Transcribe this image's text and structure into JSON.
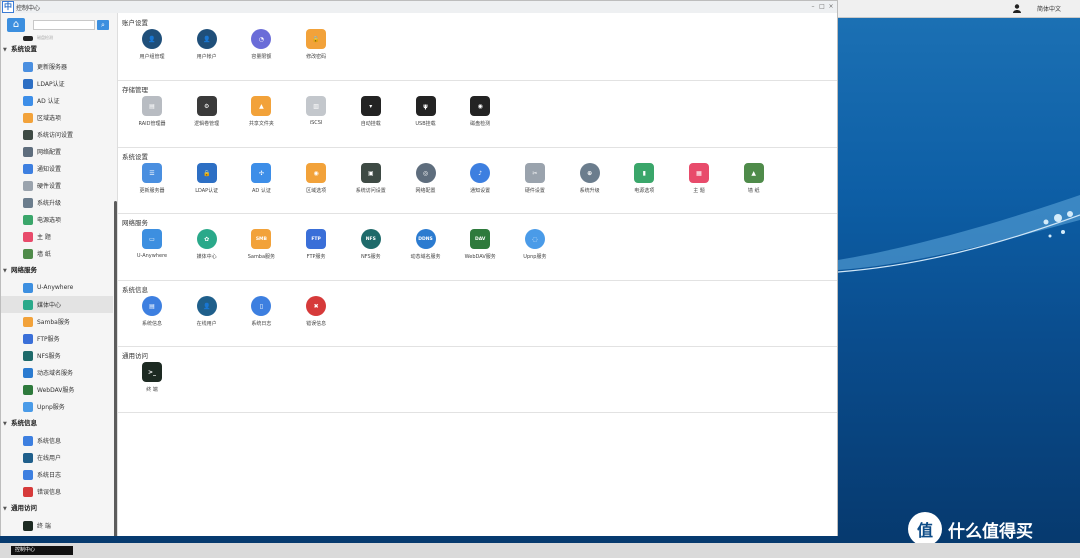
{
  "window": {
    "title": "控制中心",
    "app_icon": "中"
  },
  "desktop": {
    "language": "简体中文",
    "brand_badge": "值",
    "brand_text": "什么值得买",
    "taskbar_item": "控制中心"
  },
  "sidebar": {
    "search_placeholder": "",
    "partial_item": "磁盘检测",
    "categories": [
      {
        "label": "系统设置",
        "items": [
          {
            "label": "更新服务器",
            "icon": "server-icon",
            "color": "#4a8fe0"
          },
          {
            "label": "LDAP认证",
            "icon": "ldap-icon",
            "color": "#2d6fc4"
          },
          {
            "label": "AD 认证",
            "icon": "ad-icon",
            "color": "#3d8ee8"
          },
          {
            "label": "区域选项",
            "icon": "region-icon",
            "color": "#f2a23a"
          },
          {
            "label": "系统访问设置",
            "icon": "access-icon",
            "color": "#3e4a44"
          },
          {
            "label": "网络配置",
            "icon": "network-icon",
            "color": "#5e6d7d"
          },
          {
            "label": "通知设置",
            "icon": "bell-icon",
            "color": "#3d7fe0"
          },
          {
            "label": "硬件设置",
            "icon": "hardware-icon",
            "color": "#9aa3ad"
          },
          {
            "label": "系统升级",
            "icon": "upgrade-icon",
            "color": "#6b7d8d"
          },
          {
            "label": "电源选项",
            "icon": "power-icon",
            "color": "#3aa66a"
          },
          {
            "label": "主 题",
            "icon": "theme-icon",
            "color": "#e84b6b"
          },
          {
            "label": "墙 纸",
            "icon": "wallpaper-icon",
            "color": "#4f8b4a"
          }
        ]
      },
      {
        "label": "网络服务",
        "items": [
          {
            "label": "U-Anywhere",
            "icon": "u-anywhere-icon",
            "color": "#3d8fe0"
          },
          {
            "label": "媒体中心",
            "icon": "media-icon",
            "color": "#2aa98a",
            "active": true
          },
          {
            "label": "Samba服务",
            "icon": "samba-icon",
            "color": "#f2a23a"
          },
          {
            "label": "FTP服务",
            "icon": "ftp-icon",
            "color": "#3a6fd8"
          },
          {
            "label": "NFS服务",
            "icon": "nfs-icon",
            "color": "#1e6a6a"
          },
          {
            "label": "动态域名服务",
            "icon": "ddns-icon",
            "color": "#2b7bd0"
          },
          {
            "label": "WebDAV服务",
            "icon": "webdav-icon",
            "color": "#2e7a3c"
          },
          {
            "label": "Upnp服务",
            "icon": "upnp-icon",
            "color": "#4a9be8"
          }
        ]
      },
      {
        "label": "系统信息",
        "items": [
          {
            "label": "系统信息",
            "icon": "info-icon",
            "color": "#3d7fe0"
          },
          {
            "label": "在线用户",
            "icon": "online-user-icon",
            "color": "#1f5f8b"
          },
          {
            "label": "系统日志",
            "icon": "log-icon",
            "color": "#3d7fe0"
          },
          {
            "label": "错误信息",
            "icon": "error-icon",
            "color": "#d63a3a"
          }
        ]
      },
      {
        "label": "通用访问",
        "items": [
          {
            "label": "终 端",
            "icon": "terminal-icon",
            "color": "#1d2a22"
          }
        ]
      }
    ]
  },
  "sections": [
    {
      "title": "账户设置",
      "tiles": [
        {
          "label": "用户组管理",
          "icon": "user-group-icon",
          "color": "#1f4f7a",
          "glyph": "👤",
          "round": true
        },
        {
          "label": "用户帐户",
          "icon": "user-account-icon",
          "color": "#1f4f7a",
          "glyph": "👤",
          "round": true
        },
        {
          "label": "容量限额",
          "icon": "quota-icon",
          "color": "#6a6cd8",
          "glyph": "◔",
          "round": true
        },
        {
          "label": "修改密码",
          "icon": "lock-icon",
          "color": "#f2a23a",
          "glyph": "🔒"
        }
      ]
    },
    {
      "title": "存储管理",
      "tiles": [
        {
          "label": "RAID管理器",
          "icon": "raid-icon",
          "color": "#b8bcc2",
          "glyph": "▤"
        },
        {
          "label": "逻辑卷管理",
          "icon": "lvm-icon",
          "color": "#3a3a3a",
          "glyph": "⚙"
        },
        {
          "label": "共享文件夹",
          "icon": "share-folder-icon",
          "color": "#f2a23a",
          "glyph": "▲"
        },
        {
          "label": "iSCSI",
          "icon": "iscsi-icon",
          "color": "#c3c7cc",
          "glyph": "▥"
        },
        {
          "label": "自动挂载",
          "icon": "automount-icon",
          "color": "#232323",
          "glyph": "▾"
        },
        {
          "label": "USB挂载",
          "icon": "usb-icon",
          "color": "#232323",
          "glyph": "ψ"
        },
        {
          "label": "磁盘检测",
          "icon": "disk-check-icon",
          "color": "#232323",
          "glyph": "◉"
        }
      ]
    },
    {
      "title": "系统设置",
      "tiles": [
        {
          "label": "更新服务器",
          "icon": "server-icon",
          "color": "#4a8fe0",
          "glyph": "☰"
        },
        {
          "label": "LDAP认证",
          "icon": "ldap-icon",
          "color": "#2d6fc4",
          "glyph": "🔒"
        },
        {
          "label": "AD 认证",
          "icon": "ad-icon",
          "color": "#3d8ee8",
          "glyph": "✣"
        },
        {
          "label": "区域选项",
          "icon": "region-icon",
          "color": "#f2a23a",
          "glyph": "◉"
        },
        {
          "label": "系统访问设置",
          "icon": "access-icon",
          "color": "#3e4a44",
          "glyph": "▣"
        },
        {
          "label": "网络配置",
          "icon": "network-icon",
          "color": "#5e6d7d",
          "glyph": "◎",
          "round": true
        },
        {
          "label": "通知设置",
          "icon": "bell-icon",
          "color": "#3d7fe0",
          "glyph": "♪",
          "round": true
        },
        {
          "label": "硬件设置",
          "icon": "hardware-icon",
          "color": "#9aa3ad",
          "glyph": "✂"
        },
        {
          "label": "系统升级",
          "icon": "upgrade-icon",
          "color": "#6b7d8d",
          "glyph": "⊕",
          "round": true
        },
        {
          "label": "电源选项",
          "icon": "power-icon",
          "color": "#3aa66a",
          "glyph": "▮"
        },
        {
          "label": "主 题",
          "icon": "theme-icon",
          "color": "#e84b6b",
          "glyph": "▦"
        },
        {
          "label": "墙 纸",
          "icon": "wallpaper-icon",
          "color": "#4f8b4a",
          "glyph": "▲"
        }
      ]
    },
    {
      "title": "网络服务",
      "tiles": [
        {
          "label": "U-Anywhere",
          "icon": "u-anywhere-icon",
          "color": "#3d8fe0",
          "glyph": "▭"
        },
        {
          "label": "媒体中心",
          "icon": "media-icon",
          "color": "#2aa98a",
          "glyph": "✿",
          "round": true
        },
        {
          "label": "Samba服务",
          "icon": "samba-icon",
          "color": "#f2a23a",
          "glyph": "SMB"
        },
        {
          "label": "FTP服务",
          "icon": "ftp-icon",
          "color": "#3a6fd8",
          "glyph": "FTP"
        },
        {
          "label": "NFS服务",
          "icon": "nfs-icon",
          "color": "#1e6a6a",
          "glyph": "NFS",
          "round": true
        },
        {
          "label": "动态域名服务",
          "icon": "ddns-icon",
          "color": "#2b7bd0",
          "glyph": "DDNS",
          "round": true
        },
        {
          "label": "WebDAV服务",
          "icon": "webdav-icon",
          "color": "#2e7a3c",
          "glyph": "DAV"
        },
        {
          "label": "Upnp服务",
          "icon": "upnp-icon",
          "color": "#4a9be8",
          "glyph": "◌",
          "round": true
        }
      ]
    },
    {
      "title": "系统信息",
      "tiles": [
        {
          "label": "系统信息",
          "icon": "info-icon",
          "color": "#3d7fe0",
          "glyph": "▤",
          "round": true
        },
        {
          "label": "在线用户",
          "icon": "online-user-icon",
          "color": "#1f5f8b",
          "glyph": "👤",
          "round": true
        },
        {
          "label": "系统日志",
          "icon": "log-icon",
          "color": "#3d7fe0",
          "glyph": "▯",
          "round": true
        },
        {
          "label": "错误信息",
          "icon": "error-icon",
          "color": "#d63a3a",
          "glyph": "✖",
          "round": true
        }
      ]
    },
    {
      "title": "通用访问",
      "tiles": [
        {
          "label": "终 端",
          "icon": "terminal-icon",
          "color": "#1d2a22",
          "glyph": ">_"
        }
      ]
    }
  ]
}
